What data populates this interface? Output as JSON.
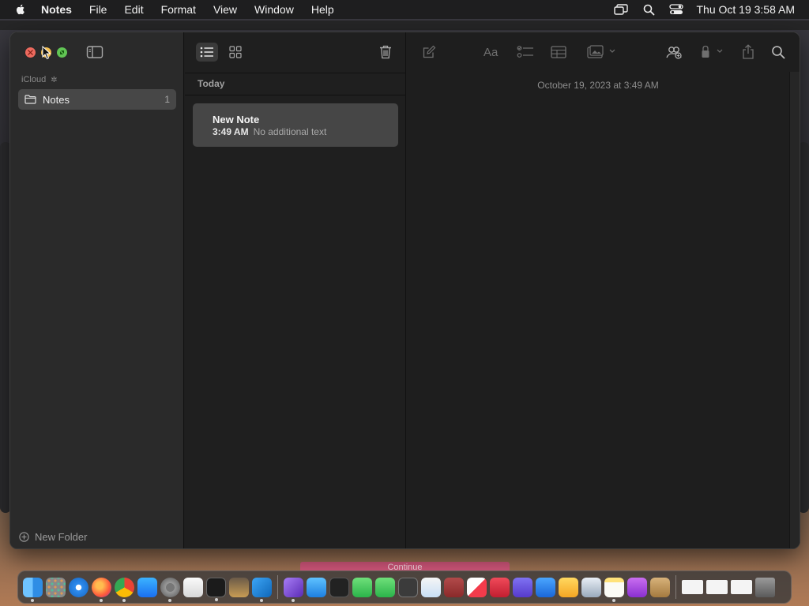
{
  "menubar": {
    "app_name": "Notes",
    "items": [
      "File",
      "Edit",
      "Format",
      "View",
      "Window",
      "Help"
    ],
    "clock": "Thu Oct 19  3:58 AM",
    "status_icons": [
      "screen-mirroring-icon",
      "spotlight-search-icon",
      "control-center-icon"
    ]
  },
  "window": {
    "sidebar": {
      "section_label": "iCloud",
      "folders": [
        {
          "name": "Notes",
          "count": "1"
        }
      ],
      "new_folder_label": "New Folder"
    },
    "list": {
      "section_header": "Today",
      "notes": [
        {
          "title": "New Note",
          "time": "3:49 AM",
          "preview": "No additional text"
        }
      ]
    },
    "editor": {
      "date": "October 19, 2023 at 3:49 AM"
    }
  },
  "dock": {
    "apps": [
      "finder",
      "launchpad",
      "safari",
      "firefox",
      "chrome",
      "app-store",
      "system-settings",
      "textedit",
      "terminal",
      "instruments",
      "vscode",
      "visual-studio",
      "onedrive",
      "activity-monitor",
      "messages",
      "facetime",
      "calculator",
      "freeform",
      "dictionary",
      "news",
      "news-badge",
      "mastodon",
      "keynote",
      "home",
      "photo-preview",
      "notes",
      "podcasts",
      "archive-utility"
    ],
    "background_windows": 3
  },
  "banner": {
    "text": "Continue"
  },
  "colors": {
    "close": "#ed6a5e",
    "minimize": "#f4bf4f",
    "zoom": "#61c554",
    "selection": "#474747"
  }
}
